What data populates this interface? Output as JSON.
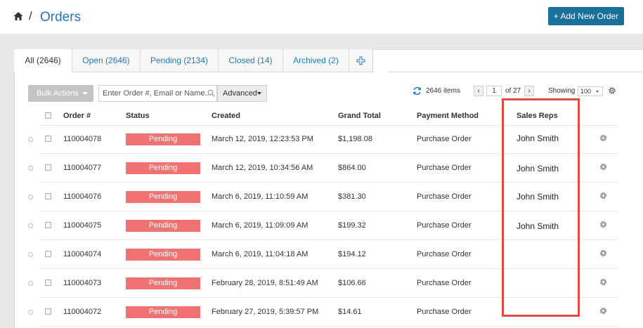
{
  "header": {
    "breadcrumb_sep": "/",
    "title": "Orders",
    "add_button": "+ Add New Order"
  },
  "tabs": [
    {
      "label": "All (2646)",
      "active": true
    },
    {
      "label": "Open (2646)",
      "active": false
    },
    {
      "label": "Pending (2134)",
      "active": false
    },
    {
      "label": "Closed (14)",
      "active": false
    },
    {
      "label": "Archived (2)",
      "active": false
    }
  ],
  "toolbar": {
    "bulk_actions": "Bulk Actions",
    "search_placeholder": "Enter Order #, Email or Name...",
    "advanced": "Advanced",
    "items_count": "2646 items",
    "prev": "‹",
    "page": "1",
    "of_pages": "of 27",
    "next": "›",
    "showing_label": "Showing",
    "per_page": "100"
  },
  "columns": {
    "order": "Order #",
    "status": "Status",
    "created": "Created",
    "grand_total": "Grand Total",
    "payment_method": "Payment Method",
    "sales_reps": "Sales Reps"
  },
  "rows": [
    {
      "order": "110004078",
      "status": "Pending",
      "created": "March 12, 2019, 12:23:53 PM",
      "total": "$1,198.08",
      "payment": "Purchase Order",
      "rep": "John Smith"
    },
    {
      "order": "110004077",
      "status": "Pending",
      "created": "March 12, 2019, 10:34:56 AM",
      "total": "$864.00",
      "payment": "Purchase Order",
      "rep": "John Smith"
    },
    {
      "order": "110004076",
      "status": "Pending",
      "created": "March 6, 2019, 11:10:59 AM",
      "total": "$381.30",
      "payment": "Purchase Order",
      "rep": "John Smith"
    },
    {
      "order": "110004075",
      "status": "Pending",
      "created": "March 6, 2019, 11:09:09 AM",
      "total": "$199.32",
      "payment": "Purchase Order",
      "rep": "John Smith"
    },
    {
      "order": "110004074",
      "status": "Pending",
      "created": "March 6, 2019, 11:04:18 AM",
      "total": "$194.12",
      "payment": "Purchase Order",
      "rep": ""
    },
    {
      "order": "110004073",
      "status": "Pending",
      "created": "February 28, 2019, 8:51:49 AM",
      "total": "$106.66",
      "payment": "Purchase Order",
      "rep": ""
    },
    {
      "order": "110004072",
      "status": "Pending",
      "created": "February 27, 2019, 5:39:57 PM",
      "total": "$14.61",
      "payment": "Purchase Order",
      "rep": ""
    }
  ],
  "icons": {
    "home": "home-icon",
    "add_tab": "plus-icon",
    "search": "search-icon",
    "refresh": "refresh-icon",
    "grid_settings": "gear-icon",
    "row_settings": "gear-icon"
  },
  "colors": {
    "accent": "#1f79b7",
    "primary_button": "#1b6f9b",
    "status_pending": "#f07272",
    "highlight": "#e24c45"
  }
}
